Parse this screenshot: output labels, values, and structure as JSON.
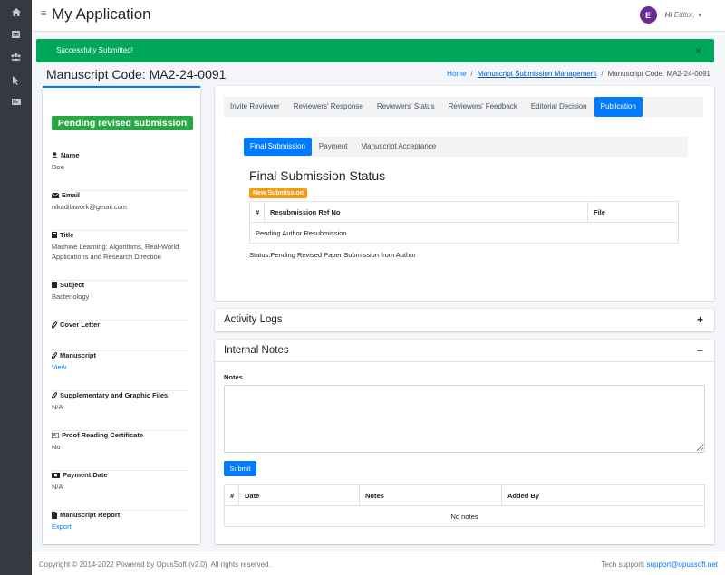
{
  "header": {
    "menu_glyph": "≡",
    "app_title": "My Application",
    "avatar_letter": "E",
    "greeting_hi": "Hi",
    "greeting_role": "Editor,",
    "caret": "▾"
  },
  "sidebar": {
    "icons": [
      "home-icon",
      "list-icon",
      "users-icon",
      "pointer-icon",
      "card-icon"
    ]
  },
  "alert": {
    "message": "Successfully Submitted!",
    "close": "×"
  },
  "page": {
    "title": "Manuscript Code: MA2-24-0091"
  },
  "breadcrumb": {
    "home": "Home",
    "sep": "/",
    "management": "Manuscript Submission Management",
    "current": "Manuscript Code: MA2-24-0091"
  },
  "profile": {
    "status": "Pending revised submission",
    "items": [
      {
        "label": "Name",
        "value": "Doe"
      },
      {
        "label": "Email",
        "value": "nikadilawork@gmail.com"
      },
      {
        "label": "Title",
        "value": "Machine Learning: Algorithms, Real-World Applications and Research Direction"
      },
      {
        "label": "Subject",
        "value": "Bacteriology"
      },
      {
        "label": "Cover Letter",
        "value": ""
      },
      {
        "label": "Manuscript",
        "value": "View"
      },
      {
        "label": "Supplementary and Graphic Files",
        "value": "N/A"
      },
      {
        "label": "Proof Reading Certificate",
        "value": "No"
      },
      {
        "label": "Payment Date",
        "value": "N/A"
      },
      {
        "label": "Manuscript Report",
        "value": "Export"
      }
    ]
  },
  "tabs": [
    "Invite Reviewer",
    "Reviewers' Response",
    "Reviewers' Status",
    "Reviewers' Feedback",
    "Editorial Decision",
    "Publication"
  ],
  "subtabs": [
    "Final Submission",
    "Payment",
    "Manuscript Acceptance"
  ],
  "final_submission": {
    "title": "Final Submission Status",
    "badge": "New Submission",
    "col_num": "#",
    "col_ref": "Resubmission Ref No",
    "col_file": "File",
    "row_text": "Pending Author Resubmission",
    "status": "Status:Pending Revised Paper Submission from Author"
  },
  "activity": {
    "title": "Activity Logs",
    "tool": "+"
  },
  "notes": {
    "title": "Internal Notes",
    "tool": "−",
    "label": "Notes",
    "placeholder": "",
    "submit": "Submit",
    "col_num": "#",
    "col_date": "Date",
    "col_notes": "Notes",
    "col_added": "Added By",
    "empty": "No notes"
  },
  "footer": {
    "copyright": "Copyright © 2014-2022 Powered by OpusSoft (v2.0). All rights reserved.",
    "support_label": "Tech support:",
    "support_email": "support@opussoft.net"
  }
}
